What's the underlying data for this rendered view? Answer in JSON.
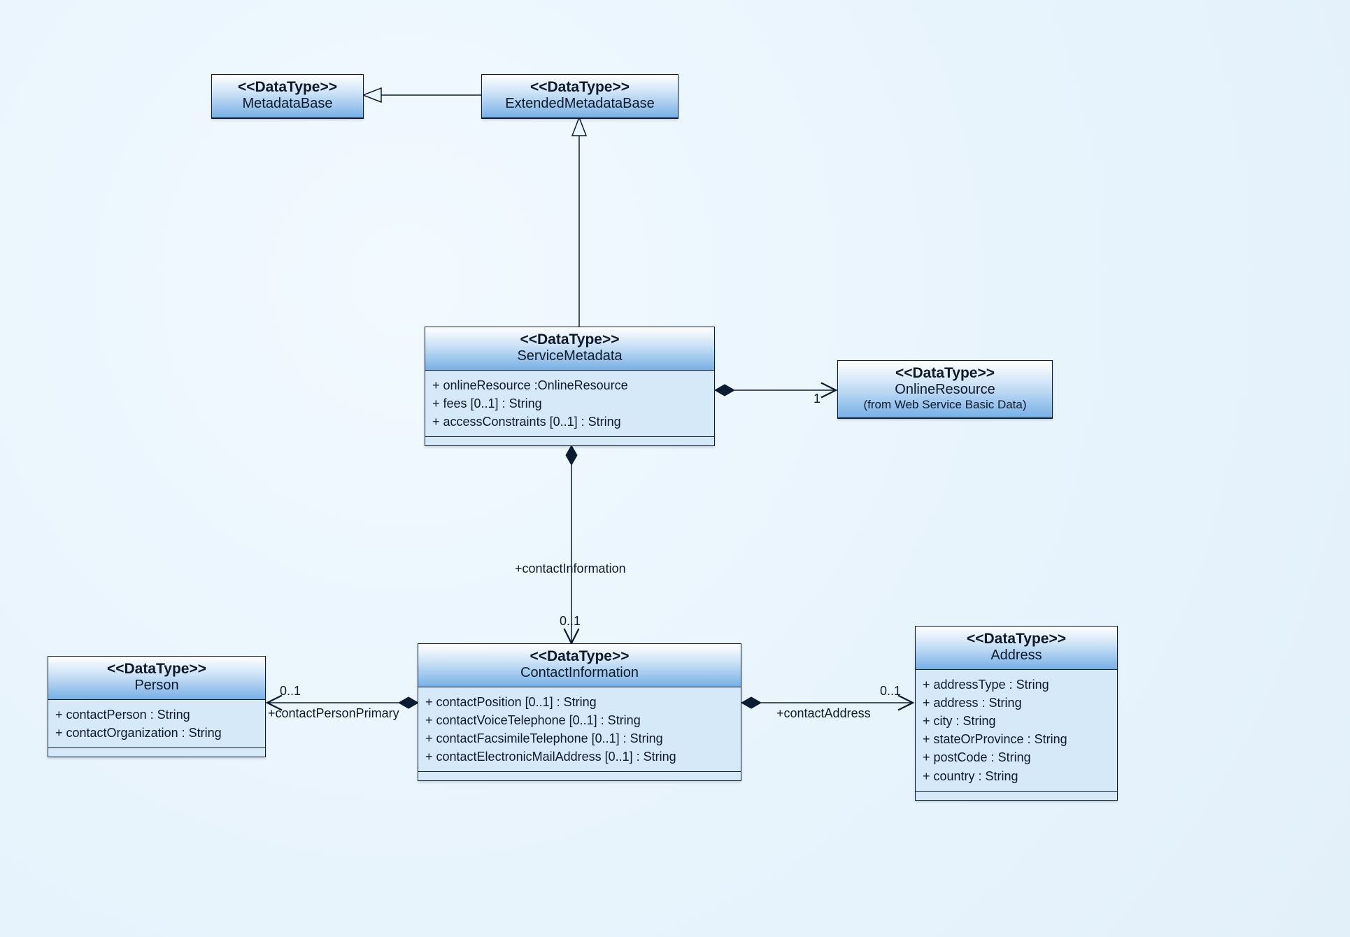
{
  "stereotype": "<<DataType>>",
  "classes": {
    "metadataBase": {
      "name": "MetadataBase"
    },
    "extendedMetadataBase": {
      "name": "ExtendedMetadataBase"
    },
    "serviceMetadata": {
      "name": "ServiceMetadata",
      "attrs": [
        "+ onlineResource :OnlineResource",
        "+ fees [0..1] : String",
        "+ accessConstraints [0..1] : String"
      ]
    },
    "onlineResource": {
      "name": "OnlineResource",
      "subnote": "(from Web Service Basic Data)"
    },
    "contactInformation": {
      "name": "ContactInformation",
      "attrs": [
        "+ contactPosition [0..1] : String",
        "+ contactVoiceTelephone [0..1] : String",
        "+ contactFacsimileTelephone [0..1] : String",
        "+ contactElectronicMailAddress [0..1] : String"
      ]
    },
    "person": {
      "name": "Person",
      "attrs": [
        "+ contactPerson : String",
        "+ contactOrganization : String"
      ]
    },
    "address": {
      "name": "Address",
      "attrs": [
        "+ addressType : String",
        "+ address : String",
        "+ city : String",
        "+ stateOrProvince : String",
        "+ postCode : String",
        "+ country : String"
      ]
    }
  },
  "labels": {
    "one": "1",
    "zeroOne": "0..1",
    "contactInformation": "+contactInformation",
    "contactPersonPrimary": "+contactPersonPrimary",
    "contactAddress": "+contactAddress"
  }
}
